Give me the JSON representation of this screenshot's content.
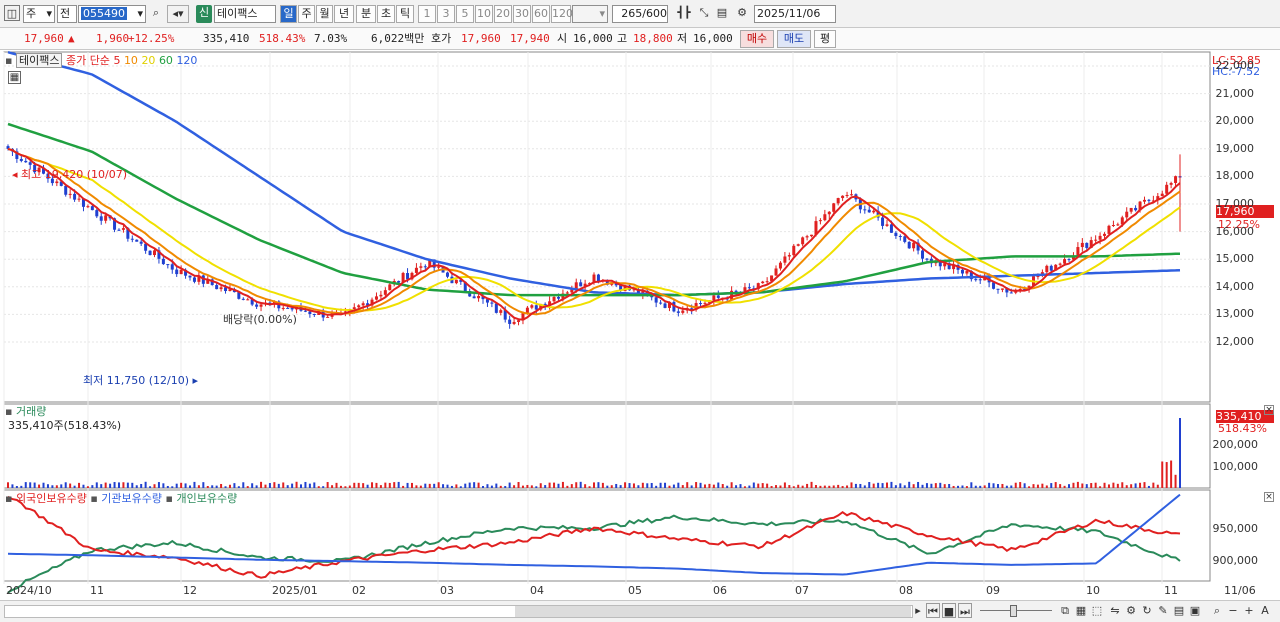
{
  "toolbar": {
    "stock_type": "주",
    "exchange": "전",
    "code": "055490",
    "new_badge": "신",
    "name": "테이팩스",
    "periods": [
      "일",
      "주",
      "월",
      "년",
      "분",
      "초",
      "틱"
    ],
    "intervals": [
      "1",
      "3",
      "5",
      "10",
      "20",
      "30",
      "60",
      "120"
    ],
    "count": "265",
    "count_total": "/600",
    "date": "2025/11/06"
  },
  "quote": {
    "price": "17,960",
    "change": "1,960",
    "change_pct": "+12.25%",
    "volume": "335,410",
    "vol_ratio": "518.43%",
    "turnover": "7.03%",
    "amount": "6,022백만",
    "ask_label": "호가",
    "ask": "17,960",
    "bid": "17,940",
    "open_label": "시",
    "open": "16,000",
    "high_label": "고",
    "high": "18,800",
    "low_label": "저",
    "low": "16,000",
    "buy": "매수",
    "sell": "매도",
    "avg": "평"
  },
  "price_pane": {
    "legend_name": "테이팩스",
    "legend_ma": "종가 단순",
    "ma_periods": [
      "5",
      "10",
      "20",
      "60",
      "120"
    ],
    "lc": "LC:52.85",
    "hc": "HC:-7.52",
    "y_ticks": [
      "22,000",
      "21,000",
      "20,000",
      "19,000",
      "18,000",
      "17,000",
      "16,000",
      "15,000",
      "14,000",
      "13,000",
      "12,000"
    ],
    "last_price": "17,960",
    "last_pct": "12.25%",
    "high_note": "최고 19,420 (10/07)",
    "low_note": "최저 11,750 (12/10)",
    "dividend_note": "배당락(0.00%)"
  },
  "volume_pane": {
    "title": "거래량",
    "value_note": "335,410주(518.43%)",
    "last": "335,410",
    "last_pct": "518.43%",
    "y_ticks": [
      "200,000",
      "100,000"
    ]
  },
  "holder_pane": {
    "legend": [
      "외국인보유수량",
      "기관보유수량",
      "개인보유수량"
    ],
    "y_ticks": [
      "950,000",
      "900,000"
    ]
  },
  "x_axis": [
    "2024/10",
    "11",
    "12",
    "2025/01",
    "02",
    "03",
    "04",
    "05",
    "06",
    "07",
    "08",
    "09",
    "10",
    "11",
    "11/06"
  ],
  "colors": {
    "up": "#e02020",
    "down": "#2040d0",
    "ma5": "#e02020",
    "ma10": "#f08a00",
    "ma20": "#f0e000",
    "ma60": "#20a040",
    "ma120": "#3060e0"
  },
  "chart_data": {
    "type": "line",
    "title": "테이팩스",
    "x": [
      "2024/10",
      "11",
      "12",
      "2025/01",
      "02",
      "03",
      "04",
      "05",
      "06",
      "07",
      "08",
      "09",
      "10",
      "11",
      "11/06"
    ],
    "series": [
      {
        "name": "종가",
        "values": [
          19000,
          16800,
          14600,
          13400,
          12900,
          14900,
          12800,
          14400,
          13200,
          14000,
          17400,
          15000,
          13800,
          15800,
          17960
        ]
      },
      {
        "name": "120",
        "values": [
          22500,
          21700,
          20000,
          18000,
          16000,
          15000,
          14300,
          13800,
          13700,
          13800,
          14100,
          14300,
          14400,
          14500,
          14600
        ]
      },
      {
        "name": "60",
        "values": [
          19900,
          18900,
          17200,
          15700,
          14500,
          13900,
          13700,
          13700,
          13700,
          13800,
          14200,
          14900,
          15100,
          15100,
          15200
        ]
      }
    ],
    "ylim": [
      11500,
      23000
    ],
    "high": 19420,
    "low": 11750
  }
}
